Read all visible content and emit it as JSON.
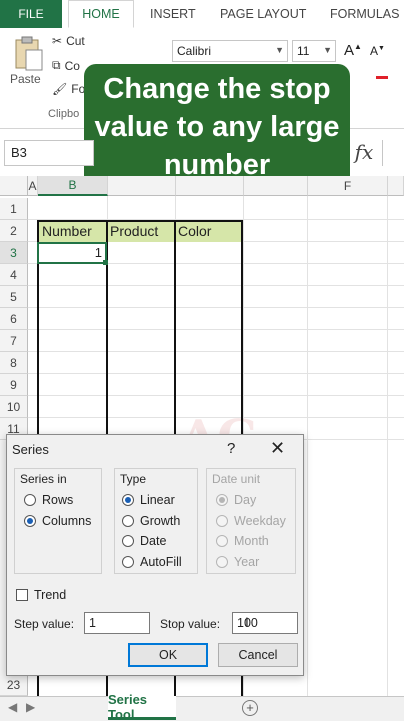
{
  "ribbon": {
    "tabs": [
      "FILE",
      "HOME",
      "INSERT",
      "PAGE LAYOUT",
      "FORMULAS"
    ],
    "paste_label": "Paste",
    "cut_label": "Cut",
    "copy_label": "Co",
    "format_label": "Fo",
    "clipboard_label": "Clipbo",
    "font_name": "Calibri",
    "font_size": "11",
    "grow_label": "A",
    "shrink_label": "A"
  },
  "overlay": {
    "text": "Change the stop value to any large number"
  },
  "formula_bar": {
    "name_box": "B3",
    "fx": "fx"
  },
  "sheet": {
    "columns": [
      "A",
      "B"
    ],
    "col_f": "F",
    "rows": [
      "1",
      "2",
      "3",
      "4",
      "5",
      "6",
      "7",
      "8",
      "9",
      "10",
      "11"
    ],
    "row_last": "23",
    "headers": [
      "Number",
      "Product",
      "Color"
    ],
    "b3_value": "1"
  },
  "dialog": {
    "title": "Series",
    "help": "?",
    "close": "✕",
    "series_in_label": "Series in",
    "series_in": [
      {
        "label": "Rows",
        "checked": false
      },
      {
        "label": "Columns",
        "checked": true
      }
    ],
    "type_label": "Type",
    "type": [
      {
        "label": "Linear",
        "checked": true
      },
      {
        "label": "Growth",
        "checked": false
      },
      {
        "label": "Date",
        "checked": false
      },
      {
        "label": "AutoFill",
        "checked": false
      }
    ],
    "date_unit_label": "Date unit",
    "date_unit": [
      {
        "label": "Day",
        "checked": true
      },
      {
        "label": "Weekday",
        "checked": false
      },
      {
        "label": "Month",
        "checked": false
      },
      {
        "label": "Year",
        "checked": false
      }
    ],
    "trend_label": "Trend",
    "step_label": "Step value:",
    "step_value": "1",
    "stop_label": "Stop value:",
    "stop_value": "100",
    "ok": "OK",
    "cancel": "Cancel"
  },
  "sheet_tabs": {
    "active": "Series Tool",
    "add": "+"
  },
  "watermark": "AG"
}
